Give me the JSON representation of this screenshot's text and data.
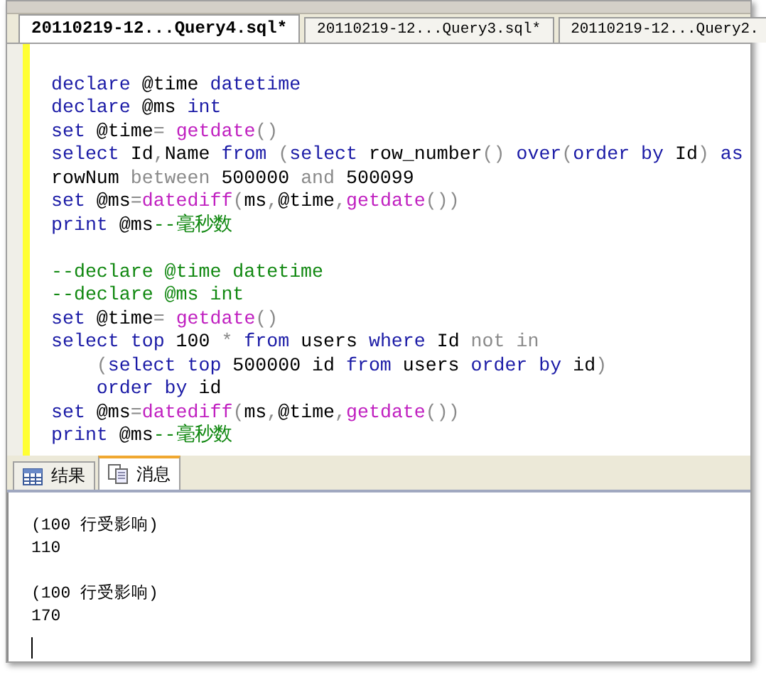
{
  "document_tabs": [
    {
      "label": "20110219-12...Query4.sql*",
      "selected": true
    },
    {
      "label": "20110219-12...Query3.sql*",
      "selected": false
    },
    {
      "label": "20110219-12...Query2.",
      "selected": false
    }
  ],
  "editor": {
    "lines": [
      {
        "kind": "blank"
      },
      {
        "kind": "code",
        "indented": false,
        "tokens": [
          {
            "kind": "kw",
            "text": "declare"
          },
          {
            "kind": "plain",
            "text": " @time "
          },
          {
            "kind": "kw",
            "text": "datetime"
          }
        ]
      },
      {
        "kind": "code",
        "indented": false,
        "tokens": [
          {
            "kind": "kw",
            "text": "declare"
          },
          {
            "kind": "plain",
            "text": " @ms "
          },
          {
            "kind": "kw",
            "text": "int"
          }
        ]
      },
      {
        "kind": "code",
        "indented": false,
        "tokens": [
          {
            "kind": "kw",
            "text": "set"
          },
          {
            "kind": "plain",
            "text": " @time"
          },
          {
            "kind": "op",
            "text": "= "
          },
          {
            "kind": "fn",
            "text": "getdate"
          },
          {
            "kind": "op",
            "text": "()"
          }
        ]
      },
      {
        "kind": "code",
        "indented": false,
        "tokens": [
          {
            "kind": "kw",
            "text": "select"
          },
          {
            "kind": "plain",
            "text": " Id"
          },
          {
            "kind": "op",
            "text": ","
          },
          {
            "kind": "plain",
            "text": "Name "
          },
          {
            "kind": "kw",
            "text": "from"
          },
          {
            "kind": "op",
            "text": " ("
          },
          {
            "kind": "kw",
            "text": "select"
          },
          {
            "kind": "plain",
            "text": " row_number"
          },
          {
            "kind": "op",
            "text": "()"
          },
          {
            "kind": "kw",
            "text": " over"
          },
          {
            "kind": "op",
            "text": "("
          },
          {
            "kind": "kw",
            "text": "order by"
          },
          {
            "kind": "plain",
            "text": " Id"
          },
          {
            "kind": "op",
            "text": ")"
          },
          {
            "kind": "kw",
            "text": " as"
          }
        ]
      },
      {
        "kind": "code",
        "indented": false,
        "tokens": [
          {
            "kind": "plain",
            "text": "rowNum "
          },
          {
            "kind": "op",
            "text": "between"
          },
          {
            "kind": "plain",
            "text": " 500000 "
          },
          {
            "kind": "op",
            "text": "and"
          },
          {
            "kind": "plain",
            "text": " 500099"
          }
        ]
      },
      {
        "kind": "code",
        "indented": false,
        "tokens": [
          {
            "kind": "kw",
            "text": "set"
          },
          {
            "kind": "plain",
            "text": " @ms"
          },
          {
            "kind": "op",
            "text": "="
          },
          {
            "kind": "fn",
            "text": "datediff"
          },
          {
            "kind": "op",
            "text": "("
          },
          {
            "kind": "plain",
            "text": "ms"
          },
          {
            "kind": "op",
            "text": ","
          },
          {
            "kind": "plain",
            "text": "@time"
          },
          {
            "kind": "op",
            "text": ","
          },
          {
            "kind": "fn",
            "text": "getdate"
          },
          {
            "kind": "op",
            "text": "())"
          }
        ]
      },
      {
        "kind": "code",
        "indented": false,
        "tokens": [
          {
            "kind": "kw",
            "text": "print"
          },
          {
            "kind": "plain",
            "text": " @ms"
          },
          {
            "kind": "comment",
            "text": "--毫秒数"
          }
        ]
      },
      {
        "kind": "blank"
      },
      {
        "kind": "code",
        "indented": false,
        "tokens": [
          {
            "kind": "comment",
            "text": "--declare @time datetime"
          }
        ]
      },
      {
        "kind": "code",
        "indented": false,
        "tokens": [
          {
            "kind": "comment",
            "text": "--declare @ms int"
          }
        ]
      },
      {
        "kind": "code",
        "indented": false,
        "tokens": [
          {
            "kind": "kw",
            "text": "set"
          },
          {
            "kind": "plain",
            "text": " @time"
          },
          {
            "kind": "op",
            "text": "= "
          },
          {
            "kind": "fn",
            "text": "getdate"
          },
          {
            "kind": "op",
            "text": "()"
          }
        ]
      },
      {
        "kind": "code",
        "indented": false,
        "tokens": [
          {
            "kind": "kw",
            "text": "select"
          },
          {
            "kind": "kw",
            "text": " top"
          },
          {
            "kind": "plain",
            "text": " 100 "
          },
          {
            "kind": "op",
            "text": "*"
          },
          {
            "kind": "kw",
            "text": " from"
          },
          {
            "kind": "plain",
            "text": " users "
          },
          {
            "kind": "kw",
            "text": "where"
          },
          {
            "kind": "plain",
            "text": " Id "
          },
          {
            "kind": "op",
            "text": "not in"
          }
        ]
      },
      {
        "kind": "code",
        "indented": true,
        "tokens": [
          {
            "kind": "op",
            "text": "("
          },
          {
            "kind": "kw",
            "text": "select"
          },
          {
            "kind": "kw",
            "text": " top"
          },
          {
            "kind": "plain",
            "text": " 500000 id "
          },
          {
            "kind": "kw",
            "text": "from"
          },
          {
            "kind": "plain",
            "text": " users "
          },
          {
            "kind": "kw",
            "text": "order by"
          },
          {
            "kind": "plain",
            "text": " id"
          },
          {
            "kind": "op",
            "text": ")"
          }
        ]
      },
      {
        "kind": "code",
        "indented": true,
        "tokens": [
          {
            "kind": "kw",
            "text": "order by"
          },
          {
            "kind": "plain",
            "text": " id"
          }
        ]
      },
      {
        "kind": "code",
        "indented": false,
        "tokens": [
          {
            "kind": "kw",
            "text": "set"
          },
          {
            "kind": "plain",
            "text": " @ms"
          },
          {
            "kind": "op",
            "text": "="
          },
          {
            "kind": "fn",
            "text": "datediff"
          },
          {
            "kind": "op",
            "text": "("
          },
          {
            "kind": "plain",
            "text": "ms"
          },
          {
            "kind": "op",
            "text": ","
          },
          {
            "kind": "plain",
            "text": "@time"
          },
          {
            "kind": "op",
            "text": ","
          },
          {
            "kind": "fn",
            "text": "getdate"
          },
          {
            "kind": "op",
            "text": "())"
          }
        ]
      },
      {
        "kind": "code",
        "indented": false,
        "tokens": [
          {
            "kind": "kw",
            "text": "print"
          },
          {
            "kind": "plain",
            "text": " @ms"
          },
          {
            "kind": "comment",
            "text": "--毫秒数"
          }
        ]
      }
    ]
  },
  "result_tabs": [
    {
      "label": "结果",
      "kind": "grid",
      "selected": false
    },
    {
      "label": "消息",
      "kind": "messages",
      "selected": true
    }
  ],
  "messages": [
    {
      "rows_affected": "(100 行受影响)",
      "elapsed": "110"
    },
    {
      "rows_affected": "(100 行受影响)",
      "elapsed": "170"
    }
  ]
}
